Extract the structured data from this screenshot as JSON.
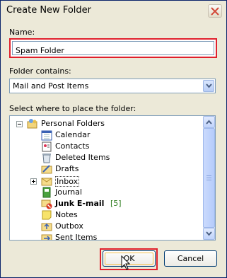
{
  "dialog": {
    "title": "Create New Folder",
    "name_label": "Name:",
    "name_value": "Spam Folder",
    "contains_label": "Folder contains:",
    "contains_value": "Mail and Post Items",
    "place_label": "Select where to place the folder:",
    "ok_label": "OK",
    "cancel_label": "Cancel"
  },
  "tree": {
    "root": "Personal Folders",
    "items": [
      {
        "label": "Calendar",
        "icon": "calendar-icon"
      },
      {
        "label": "Contacts",
        "icon": "contacts-icon"
      },
      {
        "label": "Deleted Items",
        "icon": "deleted-items-icon"
      },
      {
        "label": "Drafts",
        "icon": "drafts-icon"
      },
      {
        "label": "Inbox",
        "icon": "inbox-icon"
      },
      {
        "label": "Journal",
        "icon": "journal-icon"
      },
      {
        "label": "Junk E-mail",
        "icon": "junk-email-icon",
        "count": "[5]"
      },
      {
        "label": "Notes",
        "icon": "notes-icon"
      },
      {
        "label": "Outbox",
        "icon": "outbox-icon"
      },
      {
        "label": "Sent Items",
        "icon": "sent-items-icon"
      }
    ]
  },
  "colors": {
    "highlight": "#e0202c",
    "unread_count": "#2f7d1f"
  }
}
